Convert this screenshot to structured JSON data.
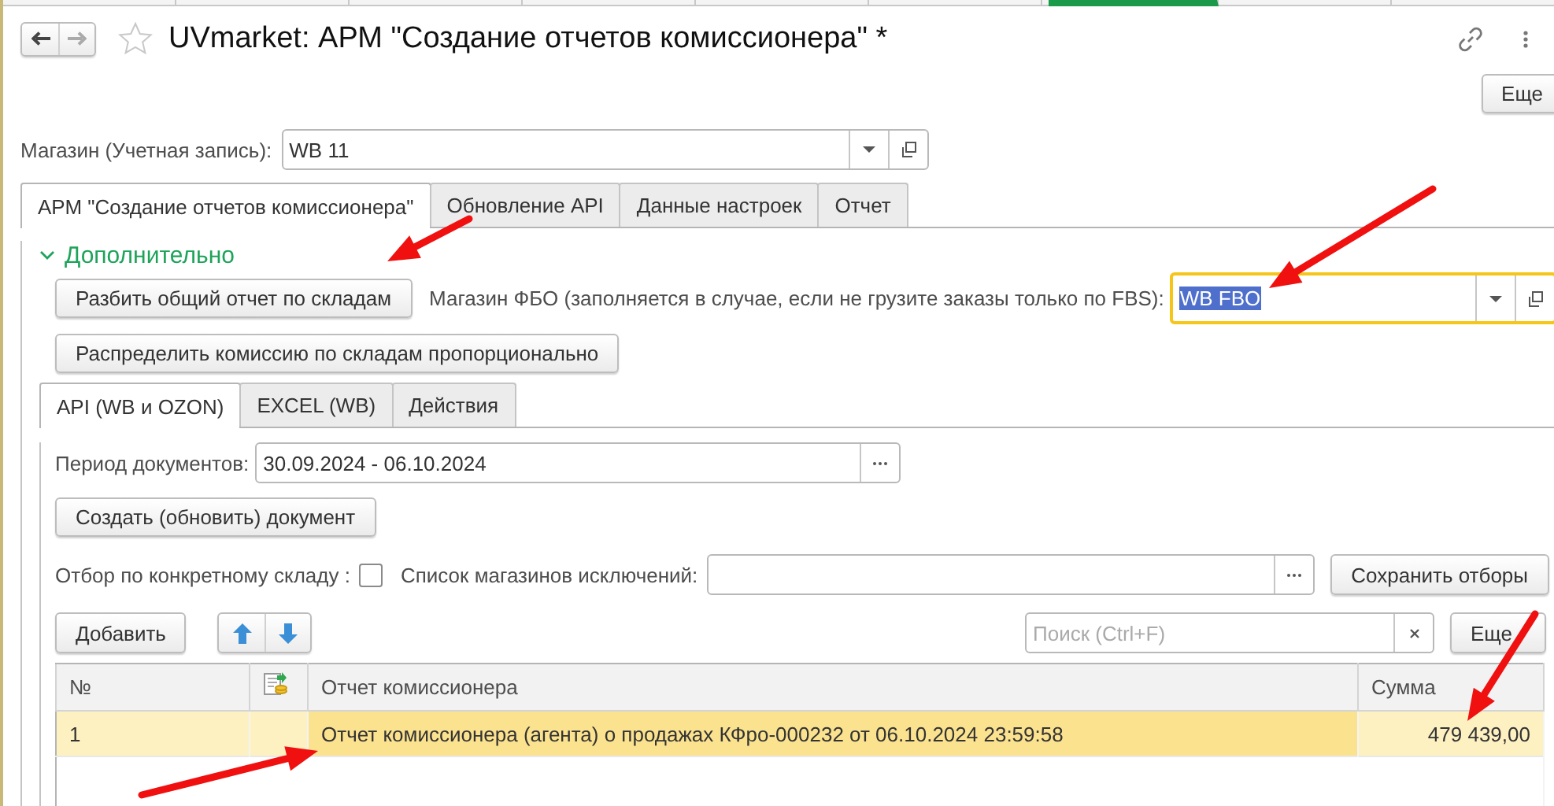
{
  "window": {
    "title": "UVmarket: АРМ \"Создание отчетов комиссионера\" *"
  },
  "header_more_button": "Еще",
  "store": {
    "label": "Магазин (Учетная запись):",
    "value": "WB 11"
  },
  "tabs": [
    {
      "label": "АРМ \"Создание отчетов комиссионера\"",
      "selected": true
    },
    {
      "label": "Обновление API",
      "selected": false
    },
    {
      "label": "Данные настроек",
      "selected": false
    },
    {
      "label": "Отчет",
      "selected": false
    }
  ],
  "section": {
    "title": "Дополнительно",
    "expanded": true
  },
  "split_button": "Разбить общий отчет по складам",
  "fbo_store": {
    "label": "Магазин ФБО (заполняется в случае, если не грузите заказы только по FBS):",
    "value": "WB FBO",
    "focused": true
  },
  "distribute_button": "Распределить комиссию по складам пропорционально",
  "inner_tabs": [
    {
      "label": "API (WB и OZON)",
      "selected": true
    },
    {
      "label": "EXCEL (WB)",
      "selected": false
    },
    {
      "label": "Действия",
      "selected": false
    }
  ],
  "period": {
    "label": "Период документов:",
    "value": "30.09.2024 - 06.10.2024"
  },
  "create_button": "Создать (обновить) документ",
  "warehouse_filter": {
    "label": "Отбор по конкретному складу :",
    "checked": false
  },
  "exclusions": {
    "label": "Список магазинов исключений:"
  },
  "save_filters_button": "Сохранить отборы",
  "add_button": "Добавить",
  "search": {
    "placeholder": "Поиск (Ctrl+F)"
  },
  "more_button": "Еще",
  "table": {
    "columns": [
      {
        "kind": "text",
        "label": "№"
      },
      {
        "kind": "icon"
      },
      {
        "kind": "text",
        "label": "Отчет комиссионера"
      },
      {
        "kind": "text",
        "label": "Сумма"
      }
    ],
    "rows": [
      {
        "number": "1",
        "report": "Отчет комиссионера (агента) о продажах КФро-000232 от 06.10.2024 23:59:58",
        "sum": "479 439,00",
        "selected": true
      }
    ]
  }
}
